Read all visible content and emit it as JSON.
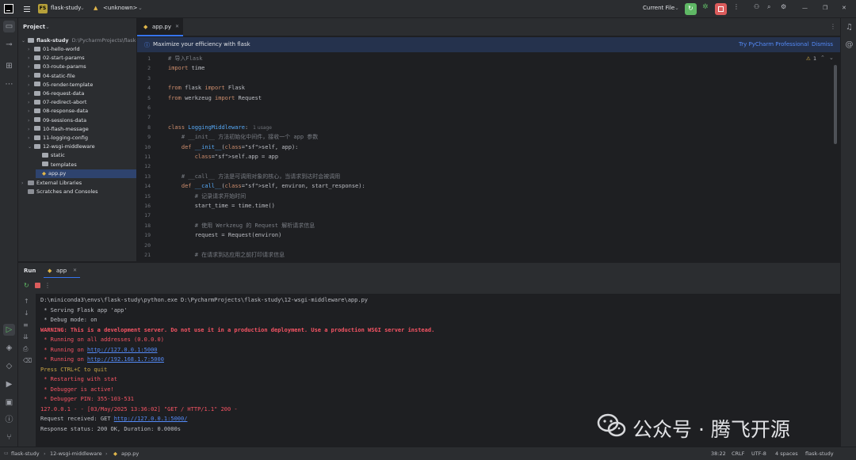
{
  "titlebar": {
    "project_badge": "FS",
    "project_name": "flask-study",
    "branch": "<unknown>",
    "run_config": "Current File"
  },
  "project_panel": {
    "title": "Project",
    "root_name": "flask-study",
    "root_path": "D:\\PycharmProjects\\flask-study",
    "items": [
      {
        "label": "01-hello-world"
      },
      {
        "label": "02-start-params"
      },
      {
        "label": "03-route-params"
      },
      {
        "label": "04-static-file"
      },
      {
        "label": "05-render-template"
      },
      {
        "label": "06-request-data"
      },
      {
        "label": "07-redirect-abort"
      },
      {
        "label": "08-response-data"
      },
      {
        "label": "09-sessions-data"
      },
      {
        "label": "10-flash-message"
      },
      {
        "label": "11-logging-config"
      },
      {
        "label": "12-wsgi-middleware"
      }
    ],
    "children": [
      {
        "label": "static"
      },
      {
        "label": "templates"
      },
      {
        "label": "app.py"
      }
    ],
    "external": "External Libraries",
    "scratches": "Scratches and Consoles"
  },
  "editor": {
    "tab_label": "app.py",
    "banner_text": "Maximize your efficiency with flask",
    "banner_try": "Try PyCharm Professional",
    "banner_dismiss": "Dismiss",
    "warnings": "1",
    "usages_hint": "1 usage",
    "lines": [
      {
        "n": "1",
        "t": "# 导入Flask"
      },
      {
        "n": "2",
        "t": "import time"
      },
      {
        "n": "3",
        "t": ""
      },
      {
        "n": "4",
        "t": "from flask import Flask"
      },
      {
        "n": "5",
        "t": "from werkzeug import Request"
      },
      {
        "n": "6",
        "t": ""
      },
      {
        "n": "7",
        "t": ""
      },
      {
        "n": "8",
        "t": "class LoggingMiddleware:"
      },
      {
        "n": "9",
        "t": "    # __init__ 方法初始化中间件，接收一个 app 参数"
      },
      {
        "n": "10",
        "t": "    def __init__(self, app):"
      },
      {
        "n": "11",
        "t": "        self.app = app"
      },
      {
        "n": "12",
        "t": ""
      },
      {
        "n": "13",
        "t": "    # __call__ 方法是可调用对象的核心，当请求到达时会被调用"
      },
      {
        "n": "14",
        "t": "    def __call__(self, environ, start_response):"
      },
      {
        "n": "15",
        "t": "        # 记录请求开始时间"
      },
      {
        "n": "16",
        "t": "        start_time = time.time()"
      },
      {
        "n": "17",
        "t": ""
      },
      {
        "n": "18",
        "t": "        # 使用 Werkzeug 的 Request 解析请求信息"
      },
      {
        "n": "19",
        "t": "        request = Request(environ)"
      },
      {
        "n": "20",
        "t": ""
      },
      {
        "n": "21",
        "t": "        # 在请求到达应用之前打印请求信息"
      }
    ]
  },
  "run": {
    "tab_title": "Run",
    "config_tab": "app",
    "console": [
      "D:\\miniconda3\\envs\\flask-study\\python.exe D:\\PycharmProjects\\flask-study\\12-wsgi-middleware\\app.py",
      " * Serving Flask app 'app'",
      " * Debug mode: on",
      "WARNING: This is a development server. Do not use it in a production deployment. Use a production WSGI server instead.",
      " * Running on all addresses (0.0.0.0)",
      " * Running on ",
      " * Running on ",
      "Press CTRL+C to quit",
      " * Restarting with stat",
      " * Debugger is active!",
      " * Debugger PIN: 355-103-531",
      "127.0.0.1 - - [03/May/2025 13:36:02] \"GET / HTTP/1.1\" 200 -",
      "Request received: GET ",
      "Response status: 200 OK, Duration: 0.0000s"
    ],
    "links": [
      "http://127.0.0.1:5000",
      "http://192.168.1.7:5000",
      "http://127.0.0.1:5000/"
    ]
  },
  "statusbar": {
    "crumb1": "flask-study",
    "crumb2": "12-wsgi-middleware",
    "crumb3": "app.py",
    "position": "38:22",
    "line_ending": "CRLF",
    "encoding": "UTF-8",
    "indent": "4 spaces",
    "interpreter": "flask-study"
  },
  "watermark": "公众号 · 腾飞开源",
  "colors": {
    "accent": "#3574f0",
    "run_green": "#5fb865",
    "stop_red": "#db5c5c",
    "banner": "#25324d"
  }
}
